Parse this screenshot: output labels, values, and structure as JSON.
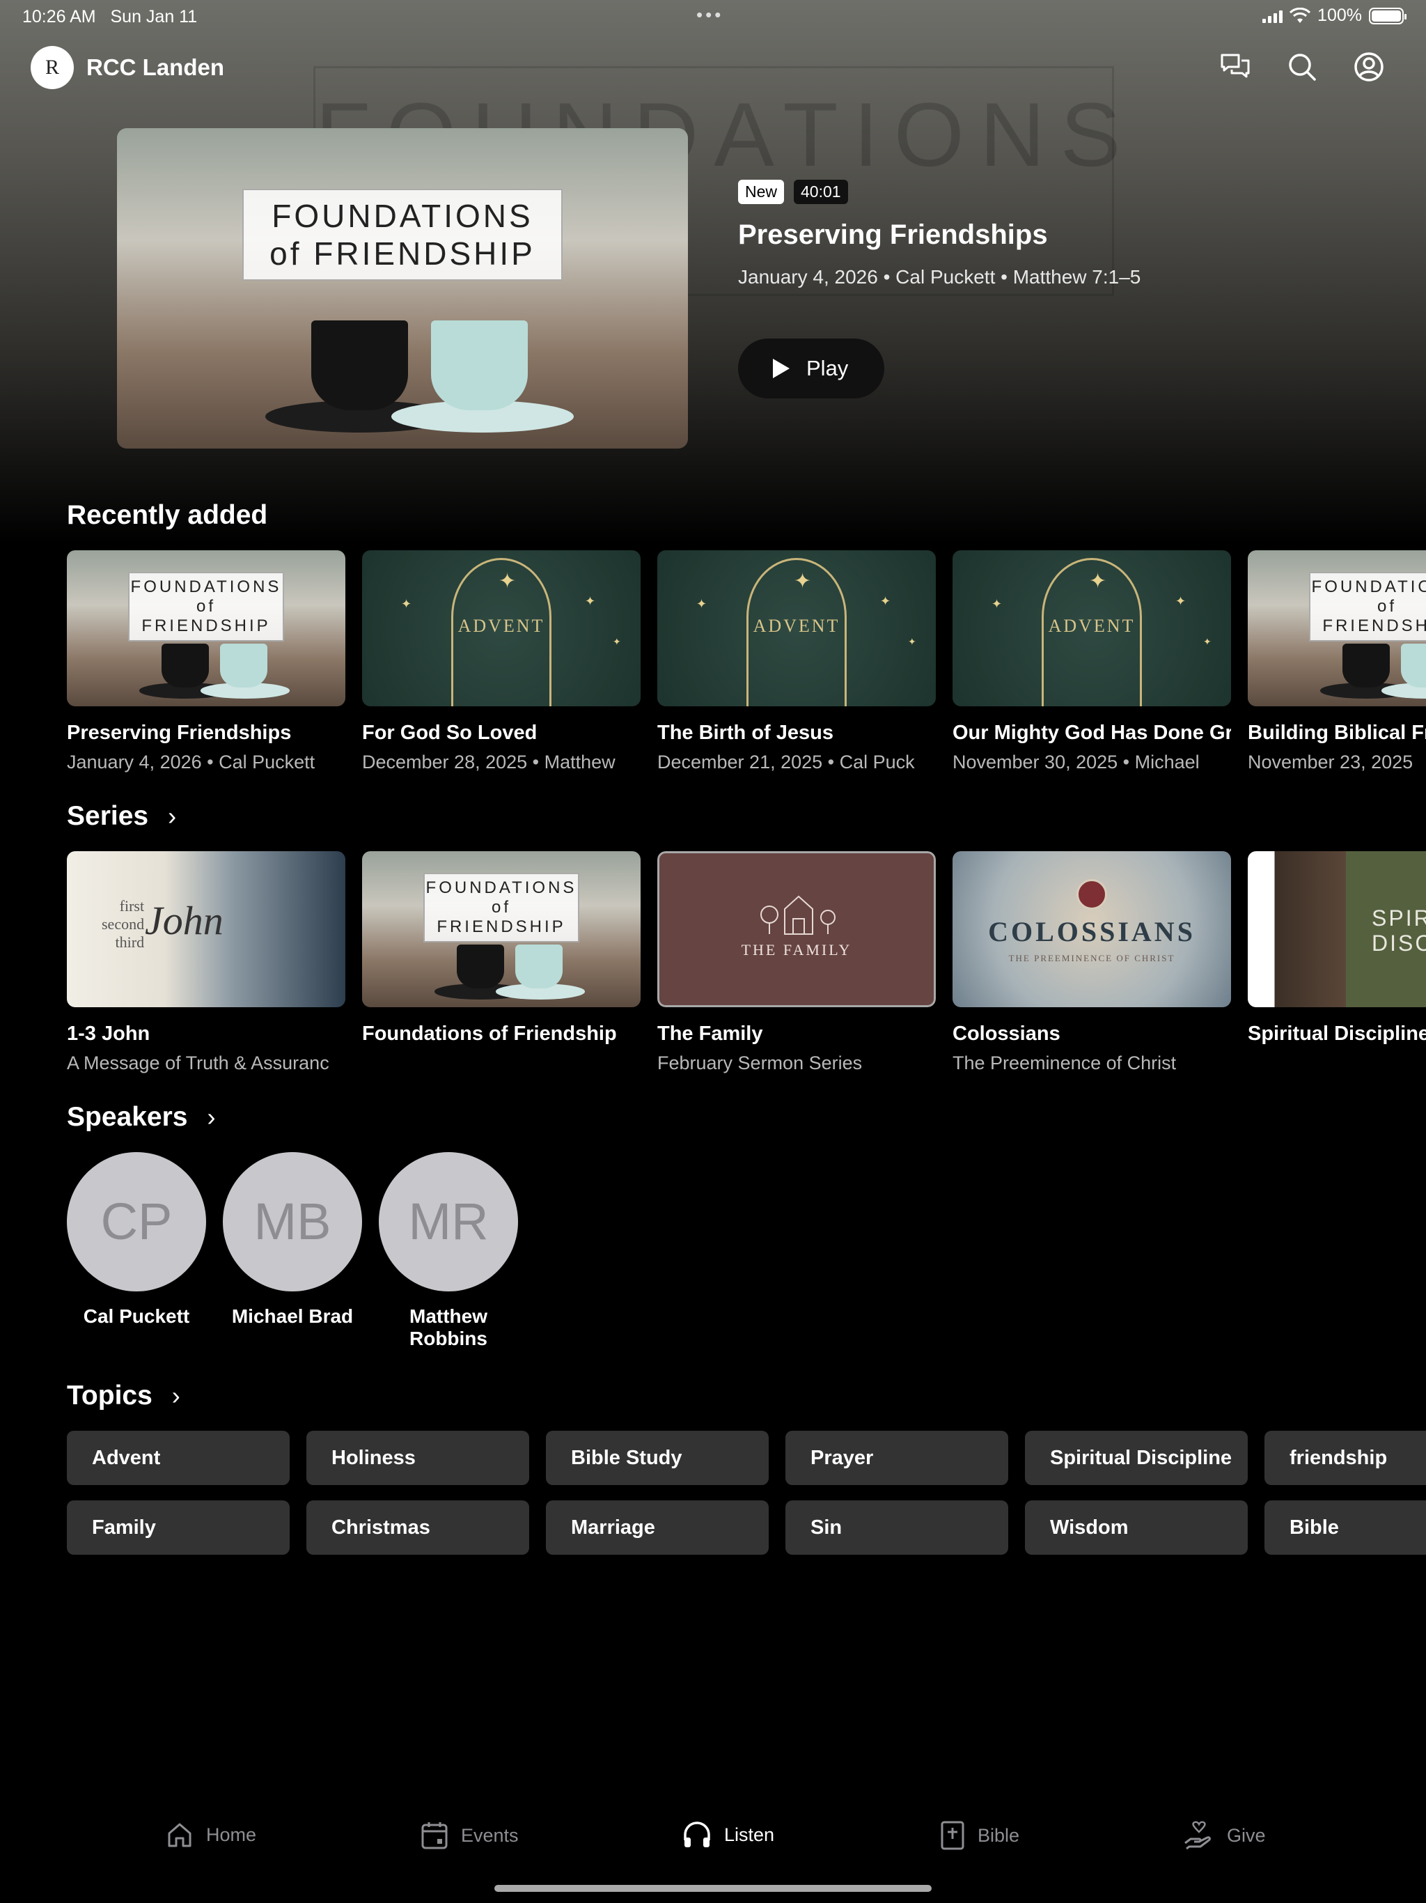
{
  "status_bar": {
    "time": "10:26 AM",
    "date": "Sun Jan 11",
    "battery": "100%"
  },
  "header": {
    "logo_text": "R",
    "title": "RCC Landen"
  },
  "hero": {
    "background_text": "FOUNDATIONS",
    "art_title_line1": "FOUNDATIONS",
    "art_title_line2": "of FRIENDSHIP",
    "badge_new": "New",
    "duration": "40:01",
    "title": "Preserving Friendships",
    "meta": "January 4, 2026 • Cal Puckett • Matthew 7:1–5",
    "play_label": "Play"
  },
  "recently_added": {
    "title": "Recently added",
    "items": [
      {
        "title": "Preserving Friendships",
        "subtitle": "January 4, 2026 • Cal Puckett",
        "art": "friendship"
      },
      {
        "title": "For God So Loved",
        "subtitle": "December 28, 2025 • Matthew",
        "art": "advent"
      },
      {
        "title": "The Birth of Jesus",
        "subtitle": "December 21, 2025 • Cal Puck",
        "art": "advent"
      },
      {
        "title": "Our Mighty God Has Done Gr",
        "subtitle": "November 30, 2025 • Michael",
        "art": "advent"
      },
      {
        "title": "Building Biblical Fr",
        "subtitle": "November 23, 2025",
        "art": "friendship"
      }
    ]
  },
  "series": {
    "title": "Series",
    "items": [
      {
        "title": "1-3 John",
        "subtitle": "A Message of Truth & Assuranc",
        "art_line1": "first",
        "art_line2": "second",
        "art_line3": "third",
        "art_script": "John"
      },
      {
        "title": "Foundations of Friendship",
        "subtitle": ""
      },
      {
        "title": "The Family",
        "subtitle": "February Sermon Series",
        "art_text": "THE FAMILY"
      },
      {
        "title": "Colossians",
        "subtitle": "The Preeminence of Christ",
        "art_text": "COLOSSIANS",
        "art_sub": "THE PREEMINENCE OF CHRIST"
      },
      {
        "title": "Spiritual Discipline",
        "subtitle": "",
        "art_line1": "SPIRIT",
        "art_line2": "DISCI"
      }
    ]
  },
  "speakers": {
    "title": "Speakers",
    "items": [
      {
        "initials": "CP",
        "name": "Cal Puckett"
      },
      {
        "initials": "MB",
        "name": "Michael Brad"
      },
      {
        "initials": "MR",
        "name": "Matthew Robbins"
      }
    ]
  },
  "topics": {
    "title": "Topics",
    "row1": [
      "Advent",
      "Holiness",
      "Bible Study",
      "Prayer",
      "Spiritual Discipline",
      "friendship"
    ],
    "row2": [
      "Family",
      "Christmas",
      "Marriage",
      "Sin",
      "Wisdom",
      "Bible"
    ]
  },
  "tabbar": {
    "items": [
      {
        "label": "Home",
        "icon": "home-icon"
      },
      {
        "label": "Events",
        "icon": "calendar-icon"
      },
      {
        "label": "Listen",
        "icon": "headphones-icon",
        "active": true
      },
      {
        "label": "Bible",
        "icon": "bible-icon"
      },
      {
        "label": "Give",
        "icon": "give-icon"
      }
    ]
  },
  "colors": {
    "background": "#000000",
    "chip": "#333333",
    "inactive_tab": "#8e8e93",
    "avatar": "#c8c7cc"
  }
}
